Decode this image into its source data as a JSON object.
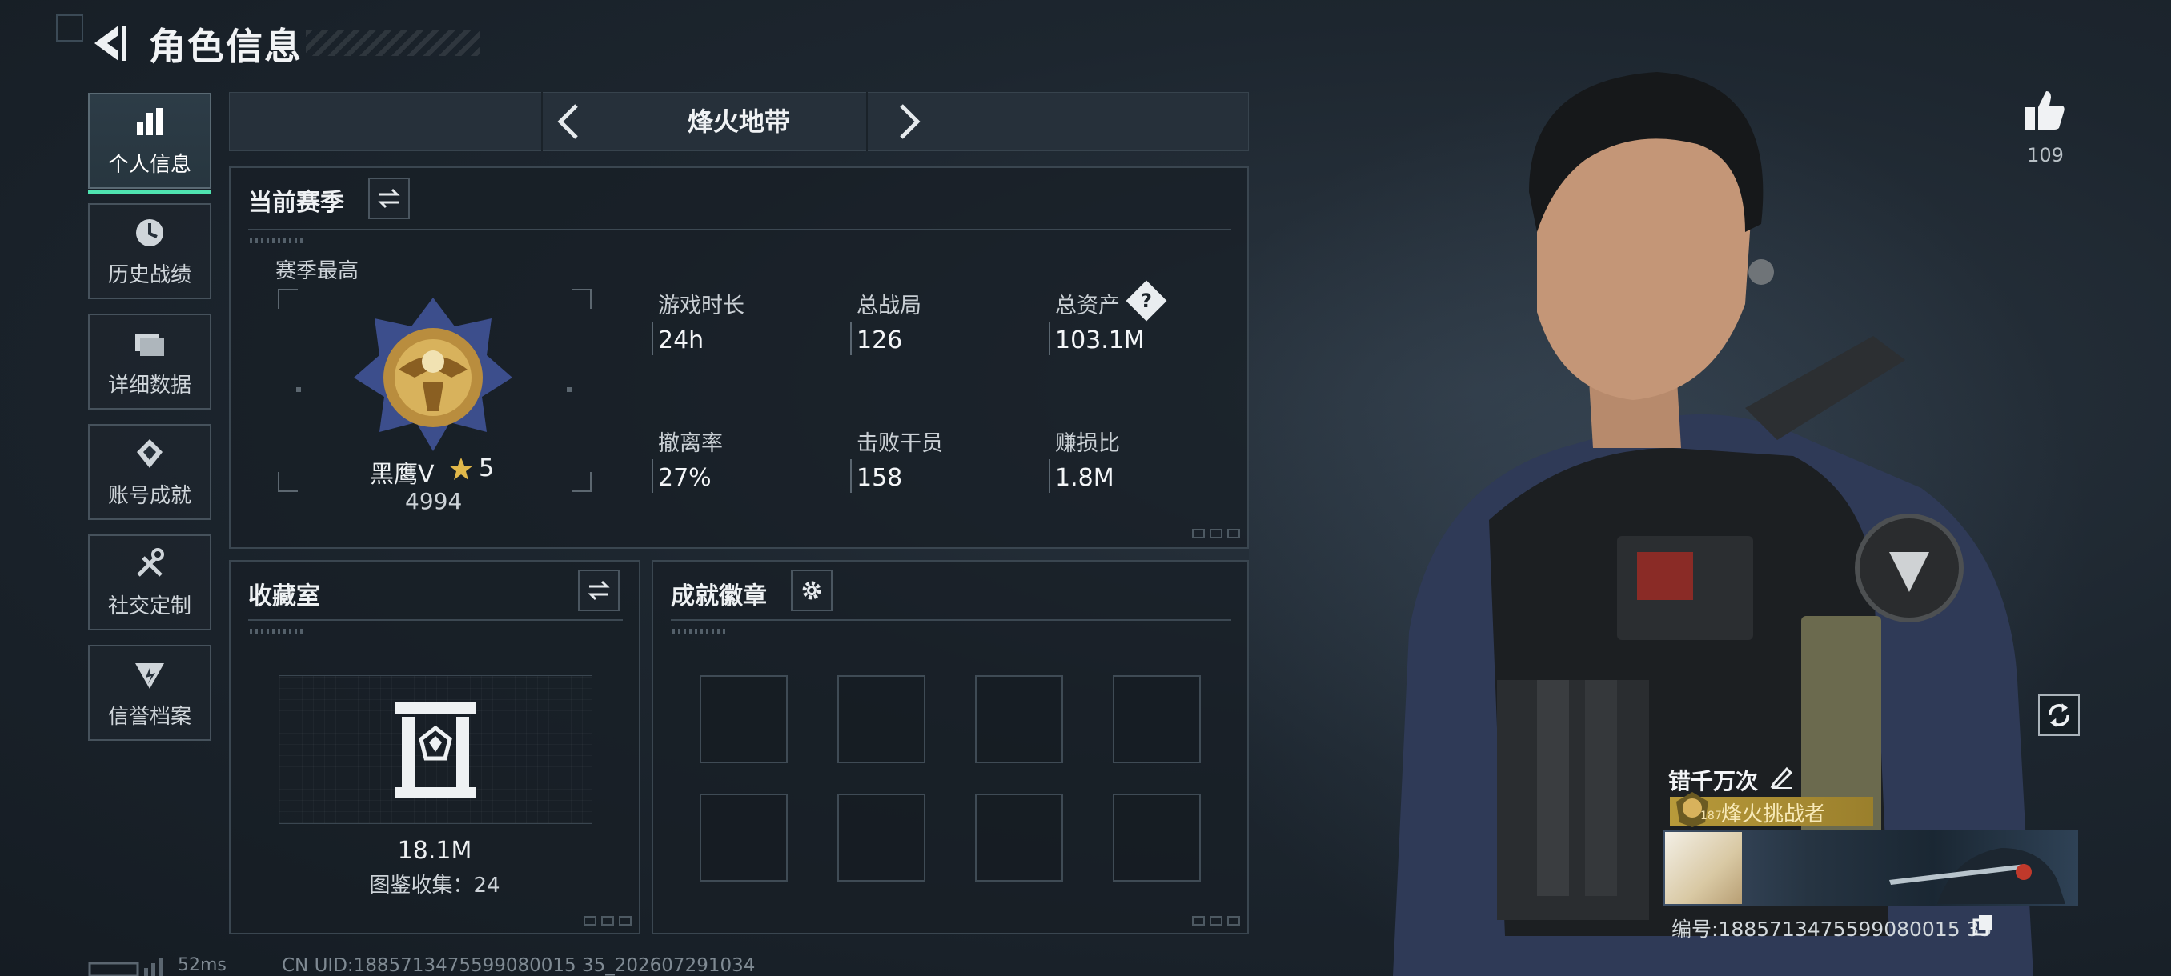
{
  "header": {
    "title": "角色信息"
  },
  "sidebar": {
    "items": [
      {
        "label": "个人信息",
        "icon": "bar-chart-icon",
        "active": true
      },
      {
        "label": "历史战绩",
        "icon": "clock-icon",
        "active": false
      },
      {
        "label": "详细数据",
        "icon": "folder-icon",
        "active": false
      },
      {
        "label": "账号成就",
        "icon": "achievement-icon",
        "active": false
      },
      {
        "label": "社交定制",
        "icon": "tools-icon",
        "active": false
      },
      {
        "label": "信誉档案",
        "icon": "shield-icon",
        "active": false
      }
    ]
  },
  "mode": {
    "name": "烽火地带"
  },
  "season": {
    "title": "当前赛季",
    "best_label": "赛季最高",
    "rank_name": "黑鹰Ⅴ",
    "rank_stars": "5",
    "rank_score": "4994",
    "stats": [
      {
        "label": "游戏时长",
        "value": "24h"
      },
      {
        "label": "总战局",
        "value": "126"
      },
      {
        "label": "总资产",
        "value": "103.1M",
        "help": "?"
      },
      {
        "label": "撤离率",
        "value": "27%"
      },
      {
        "label": "击败干员",
        "value": "158"
      },
      {
        "label": "赚损比",
        "value": "1.8M"
      }
    ]
  },
  "collection": {
    "title": "收藏室",
    "value": "18.1M",
    "catalog_text": "图鉴收集：24"
  },
  "achievements": {
    "title": "成就徽章",
    "slot_count": 8
  },
  "profile": {
    "likes": "109",
    "player_name": "错千万次",
    "title_badge": "烽火挑战者",
    "level": "187",
    "id_text": "编号:1885713475599080015 35"
  },
  "footer": {
    "ping": "52ms",
    "uid": "CN UID:1885713475599080015 35_202607291034"
  },
  "colors": {
    "accent": "#4fe3b0",
    "gold": "#b89a3a"
  }
}
